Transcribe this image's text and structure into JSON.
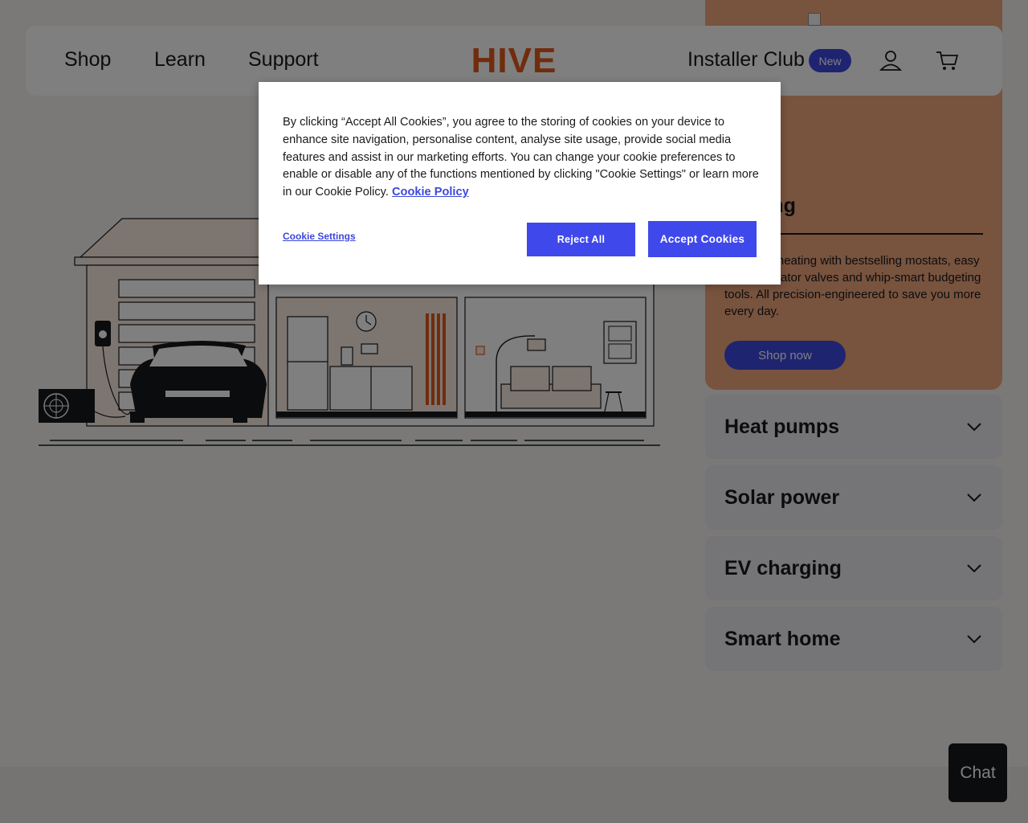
{
  "header": {
    "nav": [
      "Shop",
      "Learn",
      "Support"
    ],
    "logo_text": "HIVE",
    "installer_club": "Installer Club",
    "new_badge": "New"
  },
  "promo": {
    "title_visible": "heating",
    "description_visible": "ol of your heating with bestselling mostats, easy to use radiator valves and whip-smart budgeting tools. All precision-engineered to save you more every day.",
    "button": "Shop now"
  },
  "accordion": [
    {
      "label": "Heat pumps"
    },
    {
      "label": "Solar power"
    },
    {
      "label": "EV charging"
    },
    {
      "label": "Smart home"
    }
  ],
  "chat": {
    "label": "Chat"
  },
  "cookie": {
    "message": "By clicking “Accept All Cookies”, you agree to the storing of cookies on your device to enhance site navigation, personalise content, analyse site usage, provide social media features and assist in our marketing efforts. You can change your cookie preferences to enable or disable any of the functions mentioned by clicking \"Cookie Settings\" or learn more in our Cookie Policy.",
    "policy_link": "Cookie Policy",
    "settings_link": "Cookie Settings",
    "reject": "Reject All",
    "accept": "Accept Cookies"
  },
  "colors": {
    "brand_orange": "#e05a1c",
    "accent_blue": "#3f48e0",
    "promo_bg": "#f1a67c"
  }
}
